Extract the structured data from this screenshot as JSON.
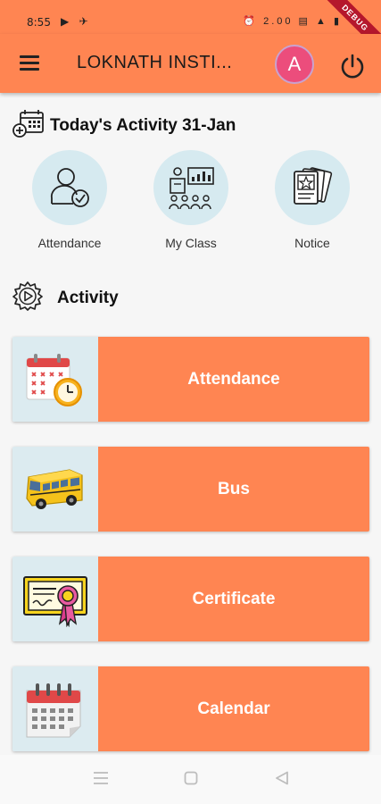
{
  "status_bar": {
    "time": "8:55",
    "left_icons": "▶ ✈",
    "right_icons": "⏰ 2.00 ▤ ▲ ▮",
    "debug_label": "DEBUG"
  },
  "app_bar": {
    "title": "LOKNATH INSTI...",
    "avatar_letter": "A",
    "menu_icon": "hamburger-menu-icon",
    "logout_icon": "power-icon"
  },
  "today": {
    "heading": "Today's Activity 31-Jan",
    "items": [
      {
        "label": "Attendance",
        "icon": "attendance-user-check-icon"
      },
      {
        "label": "My Class",
        "icon": "classroom-icon"
      },
      {
        "label": "Notice",
        "icon": "notice-cards-icon"
      }
    ]
  },
  "activity": {
    "heading": "Activity",
    "cards": [
      {
        "label": "Attendance",
        "icon": "calendar-clock-icon"
      },
      {
        "label": "Bus",
        "icon": "school-bus-icon"
      },
      {
        "label": "Certificate",
        "icon": "certificate-icon"
      },
      {
        "label": "Calendar",
        "icon": "calendar-icon"
      }
    ]
  },
  "colors": {
    "primary": "#ff8552",
    "avatar": "#ec4d7c",
    "icon_bg": "#d6eaf0"
  }
}
